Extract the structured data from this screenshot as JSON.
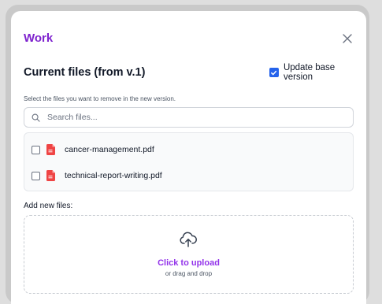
{
  "modal": {
    "title": "Work",
    "close_icon": "close-icon"
  },
  "current_files": {
    "title": "Current files (from v.1)",
    "update_base_version": {
      "label": "Update base version",
      "checked": true
    },
    "hint": "Select the files you want to remove in the new version.",
    "search": {
      "placeholder": "Search files...",
      "value": "",
      "icon": "search-icon"
    },
    "files": [
      {
        "name": "cancer-management.pdf",
        "checked": false,
        "icon": "pdf-file-icon"
      },
      {
        "name": "technical-report-writing.pdf",
        "checked": false,
        "icon": "pdf-file-icon"
      }
    ]
  },
  "add_files": {
    "label": "Add new files:",
    "upload_icon": "cloud-upload-icon",
    "click_label": "Click to upload",
    "drag_label": "or drag and drop"
  },
  "colors": {
    "title_purple": "#7e22ce",
    "upload_purple": "#9333ea",
    "checkbox_blue": "#2563eb",
    "pdf_red": "#ef4444"
  }
}
